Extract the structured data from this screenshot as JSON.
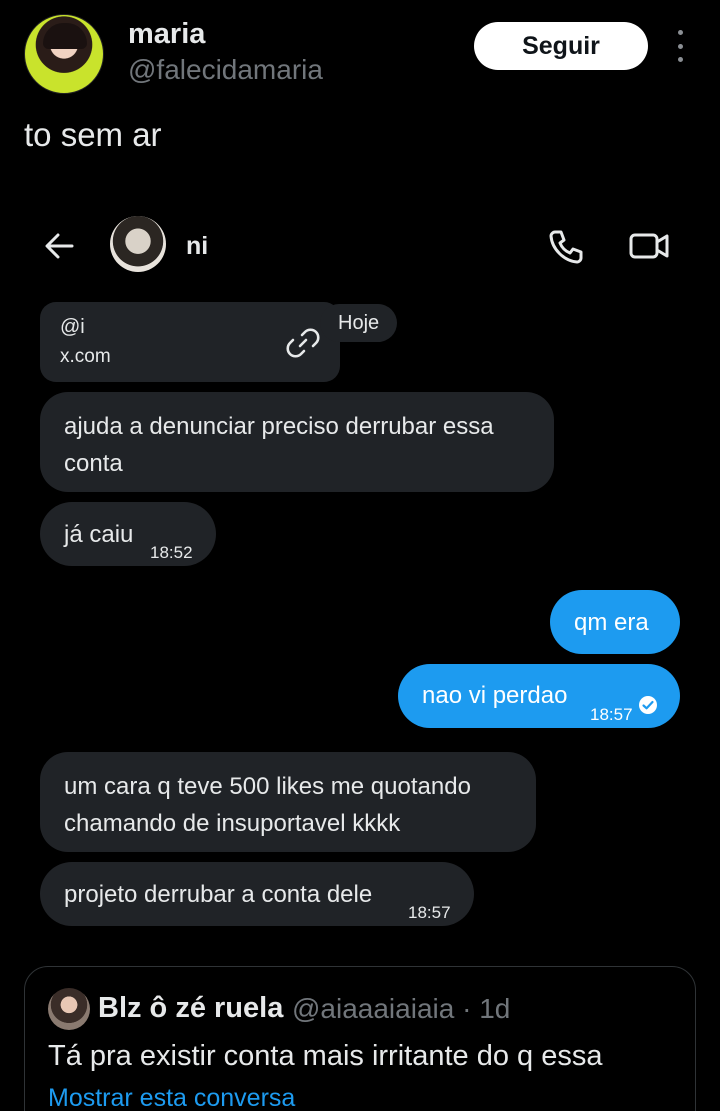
{
  "author": {
    "name": "maria",
    "handle": "@falecidamaria",
    "follow_label": "Seguir"
  },
  "tweet": {
    "text": "to sem ar"
  },
  "chat": {
    "contact_name": "ni",
    "link_card": {
      "handle": "@i",
      "domain": "x.com"
    },
    "date_label": "Hoje",
    "messages": [
      {
        "direction": "in",
        "text": "ajuda a denunciar preciso derrubar essa conta",
        "time": ""
      },
      {
        "direction": "in",
        "text": "já caiu",
        "time": "18:52"
      },
      {
        "direction": "out",
        "text": "qm era",
        "time": ""
      },
      {
        "direction": "out",
        "text": "nao vi perdao",
        "time": "18:57"
      },
      {
        "direction": "in",
        "text": "um cara q teve 500 likes me quotando chamando de insuportavel kkkk",
        "time": ""
      },
      {
        "direction": "in",
        "text": "projeto derrubar a conta dele",
        "time": "18:57"
      }
    ],
    "accent_color": "#1d9bf0",
    "incoming_bubble_color": "#202327"
  },
  "quote": {
    "name": "Blz ô zé ruela",
    "handle": "@aiaaaiaiaia · 1d",
    "text": "Tá pra existir conta mais irritante do q essa",
    "show_conversation": "Mostrar esta conversa"
  }
}
